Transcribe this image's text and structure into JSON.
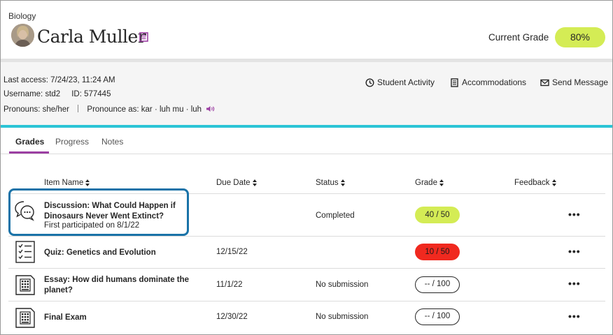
{
  "header": {
    "course": "Biology",
    "student_name": "Carla Muller",
    "current_grade_label": "Current Grade",
    "current_grade_value": "80%"
  },
  "profile": {
    "last_access_label": "Last access:",
    "last_access_value": "7/24/23, 11:24 AM",
    "username_label": "Username:",
    "username_value": "std2",
    "id_label": "ID:",
    "id_value": "577445",
    "pronouns_label": "Pronouns:",
    "pronouns_value": "she/her",
    "pronounce_label": "Pronounce as:",
    "pronounce_value": "kar · luh mu · luh"
  },
  "actions": {
    "student_activity": "Student Activity",
    "accommodations": "Accommodations",
    "send_message": "Send Message"
  },
  "tabs": [
    {
      "label": "Grades",
      "active": true
    },
    {
      "label": "Progress",
      "active": false
    },
    {
      "label": "Notes",
      "active": false
    }
  ],
  "table": {
    "headers": {
      "item_name": "Item Name",
      "due_date": "Due Date",
      "status": "Status",
      "grade": "Grade",
      "feedback": "Feedback"
    },
    "rows": [
      {
        "icon": "discussion-icon",
        "title_line1": "Discussion: What Could Happen if",
        "title_line2": "Dinosaurs Never Went Extinct?",
        "subtitle": "First participated on 8/1/22",
        "due": "",
        "status": "Completed",
        "grade": "40 / 50",
        "grade_style": "green",
        "more": "•••"
      },
      {
        "icon": "quiz-icon",
        "title_line1": "Quiz: Genetics and Evolution",
        "title_line2": "",
        "subtitle": "",
        "due": "12/15/22",
        "status": "",
        "grade": "10 / 50",
        "grade_style": "red",
        "more": "•••"
      },
      {
        "icon": "calculator-icon",
        "title_line1": "Essay: How did humans dominate the",
        "title_line2": "planet?",
        "subtitle": "",
        "due": "11/1/22",
        "status": "No submission",
        "grade": "-- / 100",
        "grade_style": "empty",
        "more": "•••"
      },
      {
        "icon": "calculator-icon",
        "title_line1": "Final Exam",
        "title_line2": "",
        "subtitle": "",
        "due": "12/30/22",
        "status": "No submission",
        "grade": "-- / 100",
        "grade_style": "empty",
        "more": "•••"
      }
    ]
  },
  "colors": {
    "accent_teal": "#2bc4d6",
    "tab_underline": "#9c3fa3",
    "grade_green": "#d4ec55",
    "grade_red": "#f0291f",
    "highlight_blue": "#1a73a8"
  }
}
